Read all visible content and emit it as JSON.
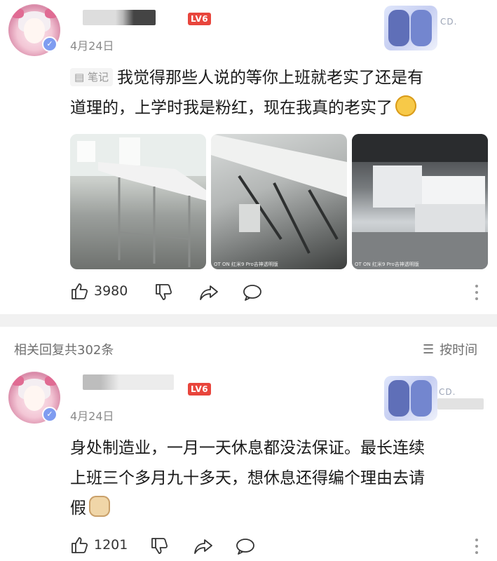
{
  "post": {
    "username": "",
    "level_badge": "LV6",
    "date": "4月24日",
    "decoration_text": "CD.",
    "tag_label": "笔记",
    "text_line1": "我觉得那些人说的等你上班就老实了还是有",
    "text_line2": "道理的，上学时我是粉红，现在我真的老实了",
    "emoji": "flushed-emoji",
    "images": [
      {
        "watermark": ""
      },
      {
        "watermark": "OT ON 红米9 Pro吉神透明版"
      },
      {
        "watermark": "OT ON 红米9 Pro吉神透明版"
      }
    ],
    "like_count": "3980"
  },
  "replies_header": {
    "title": "相关回复共302条",
    "sort_label": "按时间"
  },
  "reply": {
    "level_badge": "LV6",
    "date": "4月24日",
    "decoration_text": "CD.",
    "text_line1": "身处制造业，一月一天休息都没法保证。最长连续",
    "text_line2": "上班三个多月九十多天，想休息还得编个理由去请",
    "text_line3": "假",
    "emoji": "dog-emoji",
    "like_count": "1201"
  },
  "colors": {
    "level_badge_bg": "#e8453c",
    "divider_band": "#f1f1f1",
    "secondary_text": "#8a8a8a"
  }
}
